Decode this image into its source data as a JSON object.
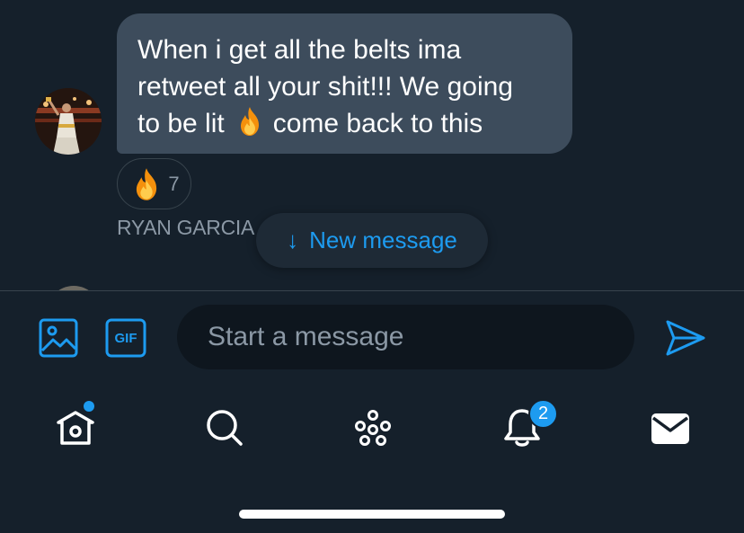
{
  "conversation": {
    "message": {
      "line1": "When i get all the belts ima",
      "line2": "retweet all your shit!!! We going",
      "line3_before": "to be lit",
      "emoji": "fire-emoji",
      "line3_after": "come back to this"
    },
    "reaction": {
      "emoji": "fire-emoji",
      "count": "7"
    },
    "sender_name": "RYAN GARCIA",
    "new_message_pill": {
      "arrow": "↓",
      "label": "New message"
    }
  },
  "composer": {
    "image_icon": "image-icon",
    "gif_label": "GIF",
    "input_placeholder": "Start a message",
    "input_value": "",
    "send_icon": "send-icon"
  },
  "tabbar": {
    "items": [
      {
        "icon": "home-icon",
        "has_dot": true
      },
      {
        "icon": "search-icon"
      },
      {
        "icon": "spaces-icon"
      },
      {
        "icon": "notifications-icon",
        "badge": "2"
      },
      {
        "icon": "messages-icon",
        "active": true
      }
    ]
  },
  "colors": {
    "background": "#15202b",
    "bubble": "#3d4c5c",
    "accent": "#1d9bf0",
    "muted_text": "#8b98a5",
    "input_bg": "#0e161e"
  }
}
